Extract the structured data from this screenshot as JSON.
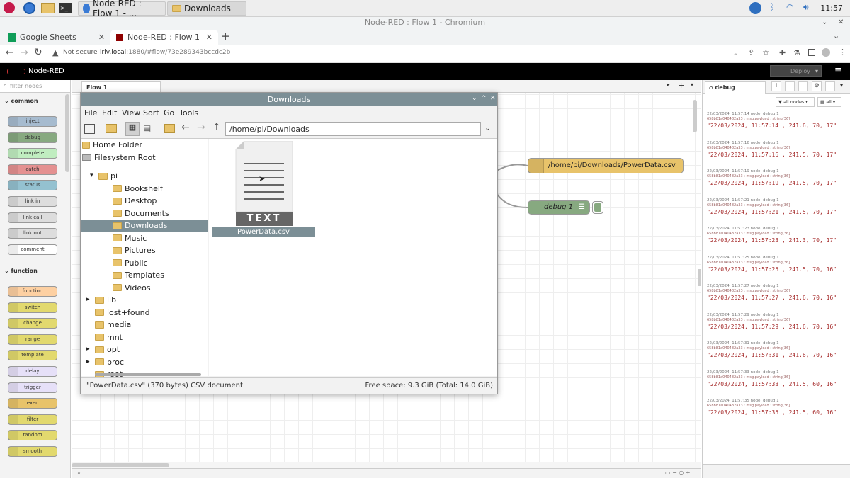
{
  "taskbar": {
    "apps": [
      {
        "label": "Node-RED : Flow 1 - ..."
      },
      {
        "label": "Downloads"
      }
    ],
    "clock": "11:57"
  },
  "chrome": {
    "window_title": "Node-RED : Flow 1 - Chromium",
    "tabs": [
      {
        "label": "Google Sheets"
      },
      {
        "label": "Node-RED : Flow 1"
      }
    ],
    "security": "Not secure",
    "url_host": "iriv.local",
    "url_rest": ":1880/#flow/73e289343bccdc2b"
  },
  "nodered": {
    "brand": "Node-RED",
    "deploy_label": "Deploy",
    "filter_placeholder": "filter nodes",
    "flow_tab": "Flow 1",
    "categories": [
      {
        "name": "common"
      },
      {
        "name": "function"
      }
    ],
    "common_nodes": [
      "inject",
      "debug",
      "complete",
      "catch",
      "status",
      "link in",
      "link call",
      "link out",
      "comment"
    ],
    "function_nodes": [
      "function",
      "switch",
      "change",
      "range",
      "template",
      "delay",
      "trigger",
      "exec",
      "filter",
      "random",
      "smooth"
    ],
    "flow_nodes": {
      "file_node": "/home/pi/Downloads/PowerData.csv",
      "debug_node": "debug 1"
    }
  },
  "sidebar": {
    "tab_label": "debug",
    "filter_all_nodes": "all nodes",
    "filter_all": "all",
    "messages": [
      {
        "meta": "22/03/2024, 11:57:14   node: debug 1",
        "src": "658b81a040482a33 : msg.payload : string[36]",
        "value": "\"22/03/2024, 11:57:14 , 241.6, 70, 17\""
      },
      {
        "meta": "22/03/2024, 11:57:16   node: debug 1",
        "src": "658b81a040482a33 : msg.payload : string[36]",
        "value": "\"22/03/2024, 11:57:16 , 241.5, 70, 17\""
      },
      {
        "meta": "22/03/2024, 11:57:19   node: debug 1",
        "src": "658b81a040482a33 : msg.payload : string[36]",
        "value": "\"22/03/2024, 11:57:19 , 241.5, 70, 17\""
      },
      {
        "meta": "22/03/2024, 11:57:21   node: debug 1",
        "src": "658b81a040482a33 : msg.payload : string[36]",
        "value": "\"22/03/2024, 11:57:21 , 241.5, 70, 17\""
      },
      {
        "meta": "22/03/2024, 11:57:23   node: debug 1",
        "src": "658b81a040482a33 : msg.payload : string[36]",
        "value": "\"22/03/2024, 11:57:23 , 241.3, 70, 17\""
      },
      {
        "meta": "22/03/2024, 11:57:25   node: debug 1",
        "src": "658b81a040482a33 : msg.payload : string[36]",
        "value": "\"22/03/2024, 11:57:25 , 241.5, 70, 16\""
      },
      {
        "meta": "22/03/2024, 11:57:27   node: debug 1",
        "src": "658b81a040482a33 : msg.payload : string[36]",
        "value": "\"22/03/2024, 11:57:27 , 241.6, 70, 16\""
      },
      {
        "meta": "22/03/2024, 11:57:29   node: debug 1",
        "src": "658b81a040482a33 : msg.payload : string[36]",
        "value": "\"22/03/2024, 11:57:29 , 241.6, 70, 16\""
      },
      {
        "meta": "22/03/2024, 11:57:31   node: debug 1",
        "src": "658b81a040482a33 : msg.payload : string[36]",
        "value": "\"22/03/2024, 11:57:31 , 241.6, 70, 16\""
      },
      {
        "meta": "22/03/2024, 11:57:33   node: debug 1",
        "src": "658b81a040482a33 : msg.payload : string[36]",
        "value": "\"22/03/2024, 11:57:33 , 241.5, 60, 16\""
      },
      {
        "meta": "22/03/2024, 11:57:35   node: debug 1",
        "src": "658b81a040482a33 : msg.payload : string[36]",
        "value": "\"22/03/2024, 11:57:35 , 241.5, 60, 16\""
      }
    ]
  },
  "filemanager": {
    "title": "Downloads",
    "menu": [
      "File",
      "Edit",
      "View",
      "Sort",
      "Go",
      "Tools"
    ],
    "path": "/home/pi/Downloads",
    "places": [
      "Home Folder",
      "Filesystem Root"
    ],
    "tree": [
      "pi",
      "Bookshelf",
      "Desktop",
      "Documents",
      "Downloads",
      "Music",
      "Pictures",
      "Public",
      "Templates",
      "Videos",
      "lib",
      "lost+found",
      "media",
      "mnt",
      "opt",
      "proc",
      "root"
    ],
    "file_name": "PowerData.csv",
    "file_badge": "TEXT",
    "status_left": "\"PowerData.csv\" (370 bytes) CSV document",
    "status_right": "Free space: 9.3 GiB (Total: 14.0 GiB)"
  },
  "colors": {
    "accent": "#7c8f96",
    "debug_value": "#a52a2a",
    "inject": "#a6bbcf",
    "debug": "#87a980",
    "function": "#fdd0a2",
    "file": "#e8c36a"
  }
}
